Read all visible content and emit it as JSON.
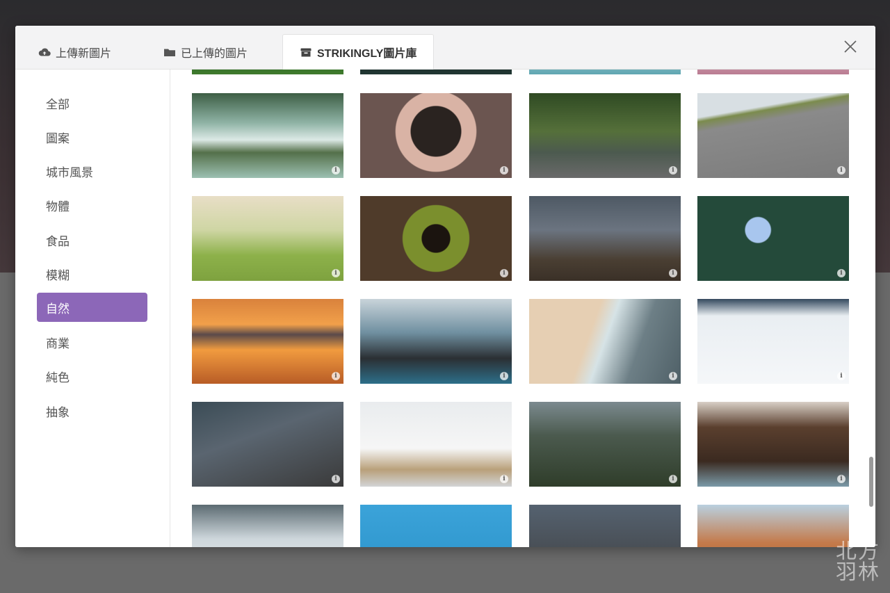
{
  "tabs": [
    {
      "label": "上傳新圖片",
      "icon": "cloud-upload-icon"
    },
    {
      "label": "已上傳的圖片",
      "icon": "folder-icon"
    },
    {
      "label": "STRIKINGLY圖片庫",
      "icon": "archive-box-icon",
      "active": true
    }
  ],
  "categories": [
    "全部",
    "圖案",
    "城市風景",
    "物體",
    "食品",
    "模糊",
    "自然",
    "商業",
    "純色",
    "抽象"
  ],
  "active_category": "自然",
  "accent_color": "#8c67b8",
  "info_glyph": "i",
  "watermark": {
    "line1": "北方",
    "line2": "羽林"
  }
}
